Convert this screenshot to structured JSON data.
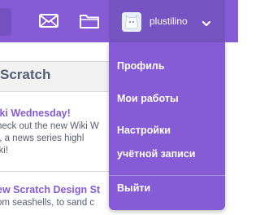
{
  "navbar": {
    "username": "plustilino",
    "icons": [
      "messages-icon",
      "my-stuff-icon",
      "dropdown-caret-icon"
    ],
    "color": "#855cd6"
  },
  "main": {
    "panel_title": "Scratch",
    "news": [
      {
        "title": "iki Wednesday!",
        "lines": [
          "heck out the new Wiki W",
          "t, a news series highl",
          "iki!"
        ]
      },
      {
        "title": "ew Scratch Design St",
        "lines": [
          "om seashells, to sand c"
        ]
      }
    ]
  },
  "account_menu": {
    "items": [
      {
        "label": "Профиль"
      },
      {
        "label": "Мои работы"
      },
      {
        "label": "Настройки"
      },
      {
        "label": "учётной записи"
      },
      {
        "label": "Выйти"
      }
    ]
  }
}
